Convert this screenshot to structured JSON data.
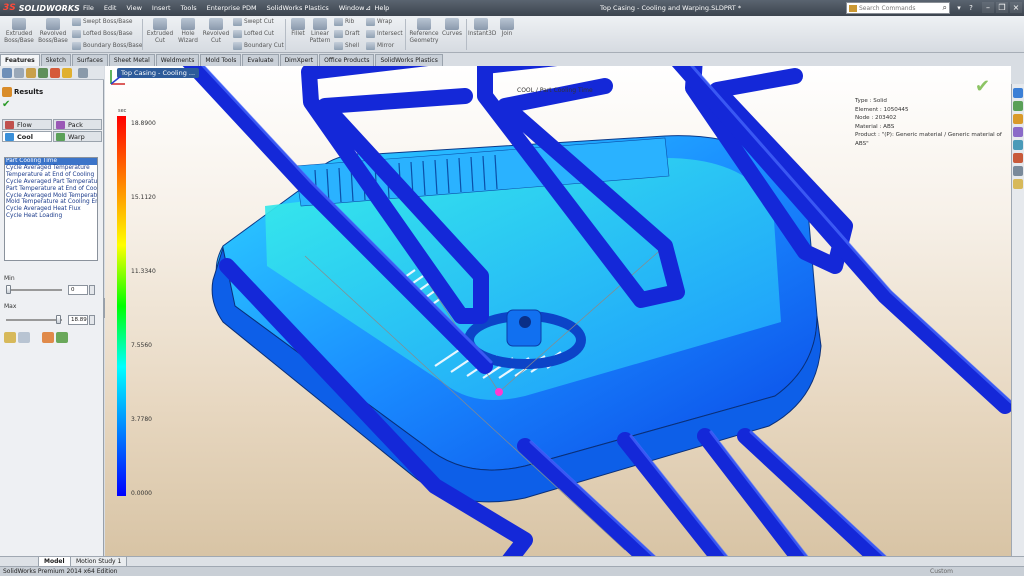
{
  "app": {
    "brand": "SOLIDWORKS",
    "window_title": "Top Casing - Cooling and Warping.SLDPRT *",
    "menus": [
      "File",
      "Edit",
      "View",
      "Insert",
      "Tools",
      "Enterprise PDM",
      "SolidWorks Plastics",
      "Window",
      "Help"
    ]
  },
  "search": {
    "placeholder": "Search Commands"
  },
  "ribbon": {
    "extruded_boss": "Extruded\nBoss/Base",
    "revolved_boss": "Revolved\nBoss/Base",
    "swept_boss": "Swept Boss/Base",
    "lofted_boss": "Lofted Boss/Base",
    "boundary_boss": "Boundary Boss/Base",
    "extruded_cut": "Extruded\nCut",
    "hole_wizard": "Hole\nWizard",
    "revolved_cut": "Revolved\nCut",
    "swept_cut": "Swept Cut",
    "lofted_cut": "Lofted Cut",
    "boundary_cut": "Boundary Cut",
    "fillet": "Fillet",
    "linear_pattern": "Linear\nPattern",
    "rib": "Rib",
    "draft": "Draft",
    "shell": "Shell",
    "wrap": "Wrap",
    "intersect": "Intersect",
    "mirror": "Mirror",
    "reference_geometry": "Reference\nGeometry",
    "curves": "Curves",
    "instant3d": "Instant3D",
    "join": "Join"
  },
  "tabs": [
    "Features",
    "Sketch",
    "Surfaces",
    "Sheet Metal",
    "Weldments",
    "Mold Tools",
    "Evaluate",
    "DimXpert",
    "Office Products",
    "SolidWorks Plastics"
  ],
  "left_panel": {
    "title": "Results",
    "tabs": {
      "flow": "Flow",
      "pack": "Pack",
      "cool": "Cool",
      "warp": "Warp"
    },
    "result_items": [
      "Part Cooling Time",
      "Cycle Averaged Temperature",
      "Temperature at End of Cooling",
      "Cycle Averaged Part Temperature",
      "Part Temperature at End of Cooling",
      "Cycle Averaged Mold Temperature",
      "Mold Temperature at Cooling End",
      "Cycle Averaged Heat Flux",
      "Cycle Heat Loading"
    ],
    "min_label": "Min",
    "min_value": "0",
    "max_label": "Max",
    "max_value": "18.89"
  },
  "viewport": {
    "breadcrumb": "Top Casing - Cooling ...",
    "plot_title": "COOL / Part Cooling Time",
    "legend_unit": "sec",
    "legend_labels": [
      "18.8900",
      "15.1120",
      "11.3340",
      "7.5560",
      "3.7780",
      "0.0000"
    ],
    "info": {
      "type": "Type : Solid",
      "element": "Element : 1050445",
      "node": "Node : 203402",
      "material": "Material : ABS",
      "product": "Product : \"(P): Generic material / Generic material of ABS\""
    }
  },
  "bottom_tabs": {
    "model": "Model",
    "motion": "Motion Study 1"
  },
  "status": {
    "left": "SolidWorks Premium 2014 x64 Edition",
    "right": "Custom"
  },
  "colors": {
    "legend_top": "#ff0000",
    "legend_bottom": "#0000ff",
    "part": "#1a8cff",
    "channels": "#1428d8"
  }
}
